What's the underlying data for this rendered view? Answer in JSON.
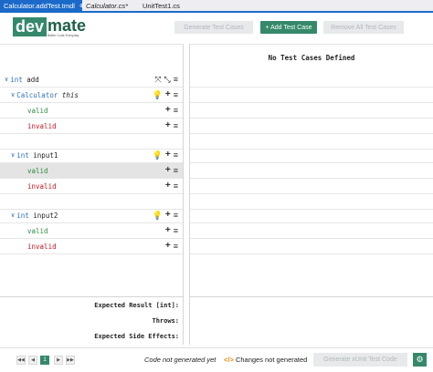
{
  "tabs": [
    {
      "label": "Calculator.addTest.tmdl",
      "pin": "⊕",
      "close": "✕"
    },
    {
      "label": "Calculator.cs*"
    },
    {
      "label": "UnitTest1.cs"
    }
  ],
  "logo": {
    "dev": "dev",
    "mate": "mate",
    "tagline": "Better Code Everyday"
  },
  "toolbar": {
    "generate_label": "Generate Test Cases",
    "add_label": "+ Add Test Case",
    "remove_label": "Remove All Test Cases"
  },
  "tree": {
    "method": {
      "type": "int",
      "name": "add"
    },
    "calculator": {
      "type": "Calculator",
      "name": "this"
    },
    "input1": {
      "type": "int",
      "name": "input1"
    },
    "input2": {
      "type": "int",
      "name": "input2"
    },
    "valid": "valid",
    "invalid": "invalid"
  },
  "results": {
    "no_cases": "No Test Cases Defined",
    "expected_result": "Expected Result [int]:",
    "throws": "Throws:",
    "side_effects": "Expected Side Effects:"
  },
  "footer": {
    "page": "1",
    "status_code": "Code not generated yet",
    "status_changes": "Changes not generated",
    "generate_xunit": "Generate xUnit Test Code"
  },
  "colors": {
    "accent": "#35896a",
    "tab_active": "#1b6ac9",
    "valid": "#2e8b3d",
    "invalid": "#c4151e"
  }
}
